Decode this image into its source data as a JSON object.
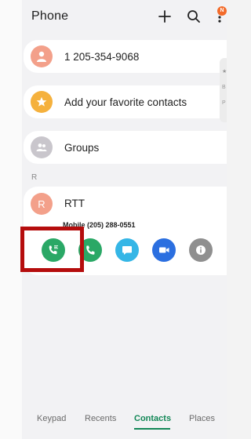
{
  "app": {
    "title": "Phone",
    "badge": "N"
  },
  "contacts": {
    "row1": {
      "label": "1 205-354-9068",
      "avatar_color": "#f3a08a"
    },
    "row2": {
      "label": "Add your favorite contacts",
      "avatar_color": "#f5b13d"
    },
    "row3": {
      "label": "Groups",
      "avatar_color": "#c9c6cc"
    },
    "section_letter": "R",
    "rtt": {
      "initial": "R",
      "label": "RTT",
      "avatar_color": "#f3a08a",
      "sub": "Mobile (205) 288-0551"
    }
  },
  "actions": [
    {
      "name": "rtt-call-button",
      "color": "#2aa866",
      "icon": "rtt-phone-icon"
    },
    {
      "name": "call-button",
      "color": "#2aa866",
      "icon": "phone-icon"
    },
    {
      "name": "message-button",
      "color": "#35b6e6",
      "icon": "message-icon"
    },
    {
      "name": "video-call-button",
      "color": "#2b6fe0",
      "icon": "video-icon"
    },
    {
      "name": "info-button",
      "color": "#8f8f8f",
      "icon": "info-icon"
    }
  ],
  "edge_peek": {
    "line1": "★",
    "line2": "B",
    "line3": "P"
  },
  "bottom_nav": {
    "keypad": "Keypad",
    "recents": "Recents",
    "contacts": "Contacts",
    "places": "Places",
    "active": "Contacts"
  }
}
